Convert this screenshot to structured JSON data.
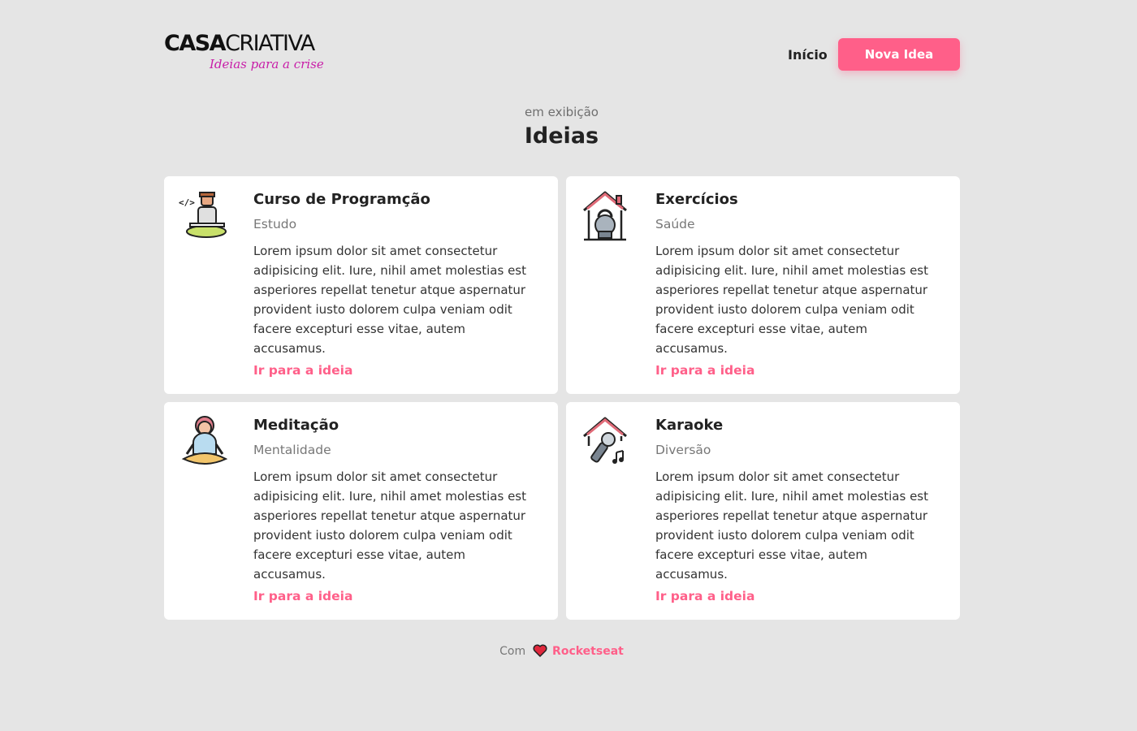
{
  "header": {
    "logo_bold": "CASA",
    "logo_light": "CRIATIVA",
    "logo_tagline": "Ideias para a crise",
    "nav_home": "Início",
    "new_idea_button": "Nova Idea"
  },
  "section": {
    "subtitle": "em exibição",
    "title": "Ideias"
  },
  "ideas": [
    {
      "title": "Curso de Programção",
      "category": "Estudo",
      "description": "Lorem ipsum dolor sit amet consectetur adipisicing elit. Iure, nihil amet molestias est asperiores repellat tenetur atque aspernatur provident iusto dolorem culpa veniam odit facere excepturi esse vitae, autem accusamus.",
      "link": "Ir para a ideia",
      "icon": "programmer-laptop-icon"
    },
    {
      "title": "Exercícios",
      "category": "Saúde",
      "description": "Lorem ipsum dolor sit amet consectetur adipisicing elit. Iure, nihil amet molestias est asperiores repellat tenetur atque aspernatur provident iusto dolorem culpa veniam odit facere excepturi esse vitae, autem accusamus.",
      "link": "Ir para a ideia",
      "icon": "home-kettlebell-icon"
    },
    {
      "title": "Meditação",
      "category": "Mentalidade",
      "description": "Lorem ipsum dolor sit amet consectetur adipisicing elit. Iure, nihil amet molestias est asperiores repellat tenetur atque aspernatur provident iusto dolorem culpa veniam odit facere excepturi esse vitae, autem accusamus.",
      "link": "Ir para a ideia",
      "icon": "meditation-person-icon"
    },
    {
      "title": "Karaoke",
      "category": "Diversão",
      "description": "Lorem ipsum dolor sit amet consectetur adipisicing elit. Iure, nihil amet molestias est asperiores repellat tenetur atque aspernatur provident iusto dolorem culpa veniam odit facere excepturi esse vitae, autem accusamus.",
      "link": "Ir para a ideia",
      "icon": "home-microphone-icon"
    }
  ],
  "footer": {
    "prefix": "Com",
    "brand": "Rocketseat",
    "icon": "heart-icon"
  },
  "colors": {
    "background": "#e5e5e5",
    "accent": "#ff5f89",
    "tagline": "#c81ea8",
    "card": "#ffffff"
  }
}
